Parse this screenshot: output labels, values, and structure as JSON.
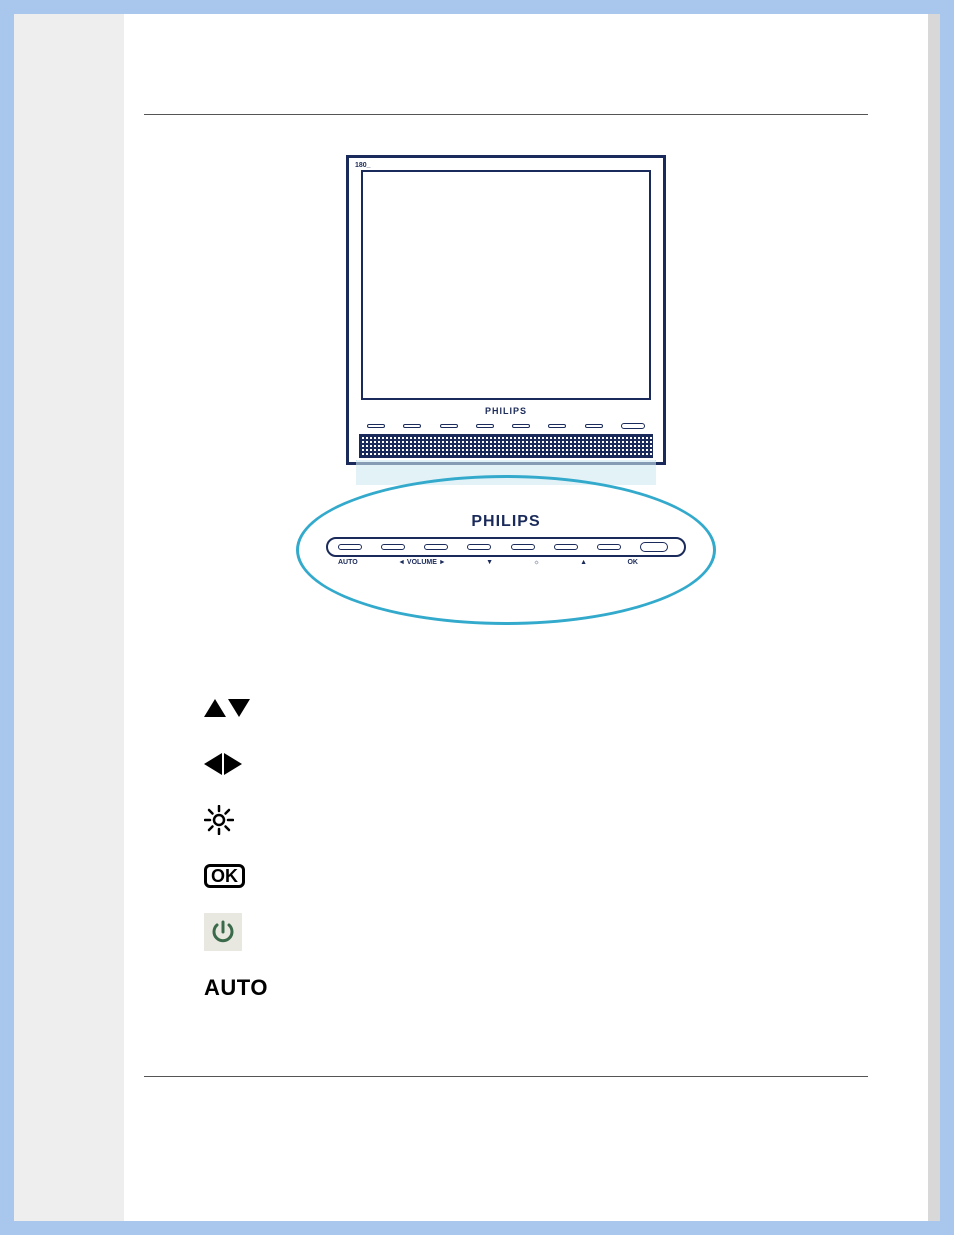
{
  "monitor": {
    "model_label": "180_",
    "brand_small": "PHILIPS",
    "brand_zoom": "PHILIPS",
    "button_labels_small": [
      "AUTO",
      "◄ VOLUME ►",
      "▼",
      "☼",
      "▲",
      "OK"
    ],
    "zoom_labels": {
      "auto": "AUTO",
      "volume": "◄   VOLUME   ►",
      "down": "▼",
      "bright": "☼",
      "up": "▲",
      "ok": "OK"
    }
  },
  "icons": {
    "ok_label": "OK",
    "auto_label": "AUTO"
  },
  "colors": {
    "accent": "#33aacc",
    "frame": "#a9c6ed",
    "ink": "#1a2a5a"
  }
}
